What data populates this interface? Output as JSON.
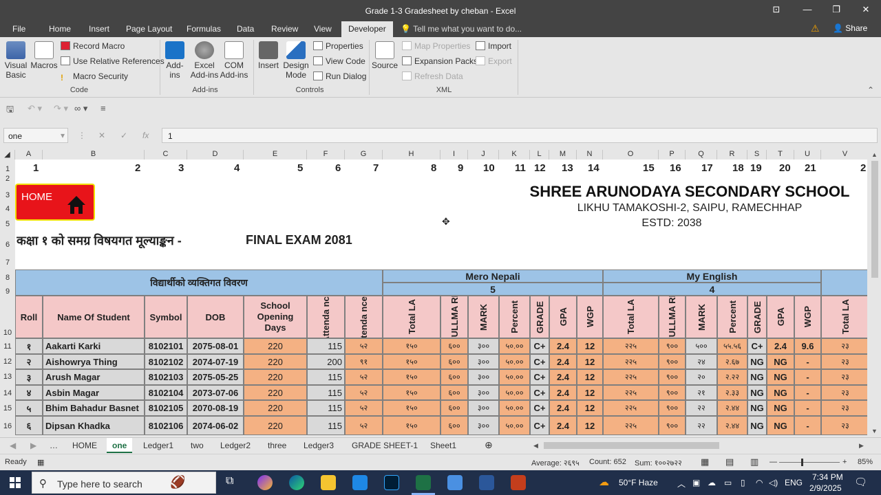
{
  "window": {
    "title": "Grade 1-3 Gradesheet by cheban - Excel"
  },
  "menu_tabs": [
    "File",
    "Home",
    "Insert",
    "Page Layout",
    "Formulas",
    "Data",
    "Review",
    "View",
    "Developer"
  ],
  "tell_me": "Tell me what you want to do...",
  "share": "Share",
  "ribbon": {
    "code": {
      "visual_basic": "Visual Basic",
      "macros": "Macros",
      "record_macro": "Record Macro",
      "use_relative": "Use Relative References",
      "macro_security": "Macro Security",
      "label": "Code"
    },
    "addins": {
      "addins": "Add-ins",
      "excel_addins": "Excel Add-ins",
      "com_addins": "COM Add-ins",
      "label": "Add-ins"
    },
    "controls": {
      "insert": "Insert",
      "design_mode": "Design Mode",
      "properties": "Properties",
      "view_code": "View Code",
      "run_dialog": "Run Dialog",
      "label": "Controls"
    },
    "xml": {
      "source": "Source",
      "map_properties": "Map Properties",
      "expansion_packs": "Expansion Packs",
      "refresh_data": "Refresh Data",
      "import": "Import",
      "export": "Export",
      "label": "XML"
    }
  },
  "formula_bar": {
    "name_box": "one",
    "formula": "1"
  },
  "columns": [
    "A",
    "B",
    "C",
    "D",
    "E",
    "F",
    "G",
    "H",
    "I",
    "J",
    "K",
    "L",
    "M",
    "N",
    "O",
    "P",
    "Q",
    "R",
    "S",
    "T",
    "U",
    "V"
  ],
  "rows": [
    "1",
    "2",
    "3",
    "4",
    "5",
    "6",
    "7",
    "8",
    "9",
    "10",
    "11",
    "12",
    "13",
    "14",
    "15",
    "16"
  ],
  "top_numbers": [
    "1",
    "2",
    "3",
    "4",
    "5",
    "6",
    "7",
    "8",
    "9",
    "10",
    "11",
    "12",
    "13",
    "14",
    "15",
    "16",
    "17",
    "18",
    "19",
    "20",
    "21",
    "2"
  ],
  "home_button": "HOME",
  "school": {
    "name": "SHREE ARUNODAYA SECONDARY SCHOOL",
    "address": "LIKHU TAMAKOSHI-2, SAIPU, RAMECHHAP",
    "estd": "ESTD: 2038"
  },
  "heading": {
    "nepali": "कक्षा १ को समग्र विषयगत मूल्याङ्कन -",
    "exam": "FINAL EXAM 2081"
  },
  "group_headers": {
    "personal": "विद्यार्थीको व्यक्तिगत विवरण",
    "mero_nepali": "Mero Nepali",
    "mero_nepali_credit": "5",
    "my_english": "My English",
    "my_english_credit": "4"
  },
  "col_headers": [
    "Roll",
    "Name Of Student",
    "Symbol",
    "DOB",
    "School Opening Days",
    "Attenda nce",
    "Attenda nce %",
    "Total LA",
    "FULLMA RK",
    "MARK",
    "Percent",
    "GRADE",
    "GPA",
    "WGP",
    "Total LA",
    "FULLMA RK",
    "MARK",
    "Percent",
    "GRADE",
    "GPA",
    "WGP",
    "Total LA"
  ],
  "students": [
    [
      "१",
      "Aakarti Karki",
      "8102101",
      "2075-08-01",
      "220",
      "115",
      "५२",
      "१५०",
      "६००",
      "३००",
      "५०.००",
      "C+",
      "2.4",
      "12",
      "२२५",
      "९००",
      "५००",
      "५५.५६",
      "C+",
      "2.4",
      "9.6",
      "२३"
    ],
    [
      "२",
      "Aishowrya Thing",
      "8102102",
      "2074-07-19",
      "220",
      "200",
      "९१",
      "१५०",
      "६००",
      "३००",
      "५०.००",
      "C+",
      "2.4",
      "12",
      "२२५",
      "९००",
      "२४",
      "२.६७",
      "NG",
      "NG",
      "-",
      "२३"
    ],
    [
      "३",
      "Arush Magar",
      "8102103",
      "2075-05-25",
      "220",
      "115",
      "५२",
      "१५०",
      "६००",
      "३००",
      "५०.००",
      "C+",
      "2.4",
      "12",
      "२२५",
      "९००",
      "२०",
      "२.२२",
      "NG",
      "NG",
      "-",
      "२३"
    ],
    [
      "४",
      "Asbin Magar",
      "8102104",
      "2073-07-06",
      "220",
      "115",
      "५२",
      "१५०",
      "६००",
      "३००",
      "५०.००",
      "C+",
      "2.4",
      "12",
      "२२५",
      "९००",
      "२१",
      "२.३३",
      "NG",
      "NG",
      "-",
      "२३"
    ],
    [
      "५",
      "Bhim Bahadur Basnet",
      "8102105",
      "2070-08-19",
      "220",
      "115",
      "५२",
      "१५०",
      "६००",
      "३००",
      "५०.००",
      "C+",
      "2.4",
      "12",
      "२२५",
      "९००",
      "२२",
      "२.४४",
      "NG",
      "NG",
      "-",
      "२३"
    ],
    [
      "६",
      "Dipsan Khadka",
      "8102106",
      "2074-06-02",
      "220",
      "115",
      "५२",
      "१५०",
      "६००",
      "३००",
      "५०.००",
      "C+",
      "2.4",
      "12",
      "२२५",
      "९००",
      "२२",
      "२.४४",
      "NG",
      "NG",
      "-",
      "२३"
    ]
  ],
  "sheet_tabs": [
    "HOME",
    "one",
    "Ledger1",
    "two",
    "Ledger2",
    "three",
    "Ledger3",
    "GRADE SHEET-1",
    "Sheet1"
  ],
  "active_sheet": "one",
  "status": {
    "ready": "Ready",
    "average": "Average: २६९५",
    "count": "Count: 652",
    "sum": "Sum: १००२७२२",
    "zoom": "85%"
  },
  "taskbar": {
    "search": "Type here to search",
    "weather": "50°F  Haze",
    "lang": "ENG",
    "time": "7:34 PM",
    "date": "2/9/2025"
  },
  "colors": {
    "excel_green": "#1e7145",
    "header_blue": "#9dc3e6",
    "header_pink": "#f4c8c8",
    "cell_tan": "#f4b183",
    "cell_grey": "#d9d9d9",
    "home_red": "#e8141a"
  }
}
